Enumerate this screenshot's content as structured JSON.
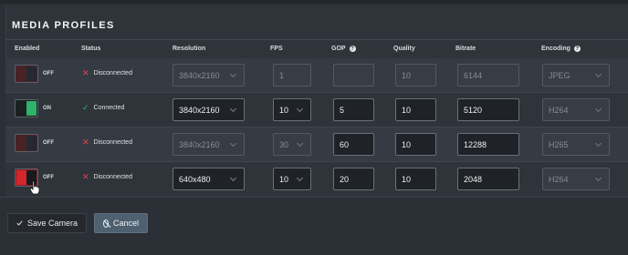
{
  "panel": {
    "title": "MEDIA PROFILES"
  },
  "headers": {
    "enabled": "Enabled",
    "status": "Status",
    "resolution": "Resolution",
    "fps": "FPS",
    "gop": "GOP",
    "quality": "Quality",
    "bitrate": "Bitrate",
    "encoding": "Encoding"
  },
  "rows": [
    {
      "enabled": false,
      "toggle_label": "OFF",
      "status": "Disconnected",
      "resolution": "3840x2160",
      "fps": "1",
      "gop": "",
      "quality": "10",
      "bitrate": "6144",
      "encoding": "JPEG"
    },
    {
      "enabled": true,
      "toggle_label": "ON",
      "status": "Connected",
      "resolution": "3840x2160",
      "fps": "10",
      "gop": "5",
      "quality": "10",
      "bitrate": "5120",
      "encoding": "H264"
    },
    {
      "enabled": false,
      "toggle_label": "OFF",
      "status": "Disconnected",
      "resolution": "3840x2160",
      "fps": "30",
      "gop": "60",
      "quality": "10",
      "bitrate": "12288",
      "encoding": "H265"
    },
    {
      "enabled": false,
      "toggle_label": "OFF",
      "status": "Disconnected",
      "resolution": "640x480",
      "fps": "10",
      "gop": "20",
      "quality": "10",
      "bitrate": "2048",
      "encoding": "H264"
    }
  ],
  "buttons": {
    "save": "Save Camera",
    "cancel": "Cancel"
  },
  "colors": {
    "connected": "#2fb36a",
    "disconnected": "#e0444b",
    "cancel_bg": "#4f6070"
  }
}
